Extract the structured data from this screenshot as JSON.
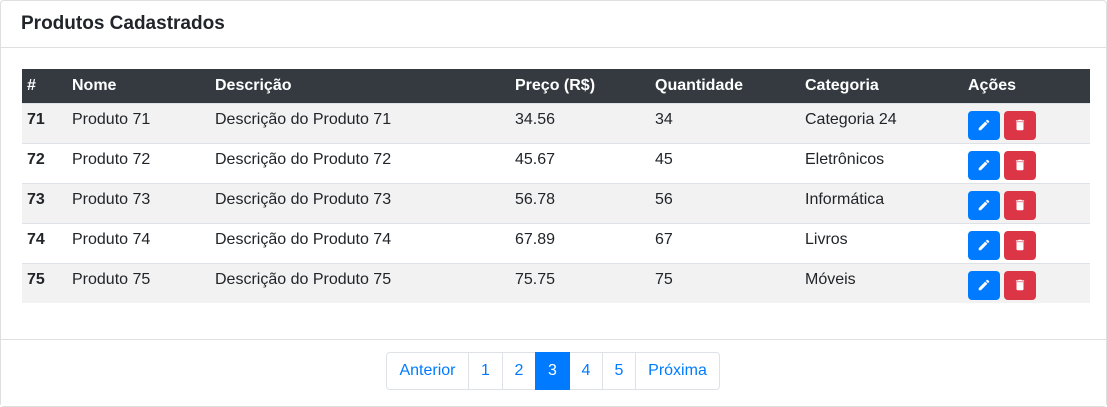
{
  "card": {
    "title": "Produtos Cadastrados"
  },
  "table": {
    "headers": [
      "#",
      "Nome",
      "Descrição",
      "Preço (R$)",
      "Quantidade",
      "Categoria",
      "Ações"
    ],
    "rows": [
      {
        "id": "71",
        "name": "Produto 71",
        "description": "Descrição do Produto 71",
        "price": "34.56",
        "quantity": "34",
        "category": "Categoria 24"
      },
      {
        "id": "72",
        "name": "Produto 72",
        "description": "Descrição do Produto 72",
        "price": "45.67",
        "quantity": "45",
        "category": "Eletrônicos"
      },
      {
        "id": "73",
        "name": "Produto 73",
        "description": "Descrição do Produto 73",
        "price": "56.78",
        "quantity": "56",
        "category": "Informática"
      },
      {
        "id": "74",
        "name": "Produto 74",
        "description": "Descrição do Produto 74",
        "price": "67.89",
        "quantity": "67",
        "category": "Livros"
      },
      {
        "id": "75",
        "name": "Produto 75",
        "description": "Descrição do Produto 75",
        "price": "75.75",
        "quantity": "75",
        "category": "Móveis"
      }
    ],
    "row_actions": [
      "pencil-icon",
      "trash-icon"
    ]
  },
  "pagination": {
    "prev_label": "Anterior",
    "pages": [
      "1",
      "2",
      "3",
      "4",
      "5"
    ],
    "current_page": "3",
    "next_label": "Próxima"
  },
  "colors": {
    "header_bg": "#343a40",
    "primary": "#007bff",
    "danger": "#dc3545",
    "stripe": "#f2f2f2"
  }
}
